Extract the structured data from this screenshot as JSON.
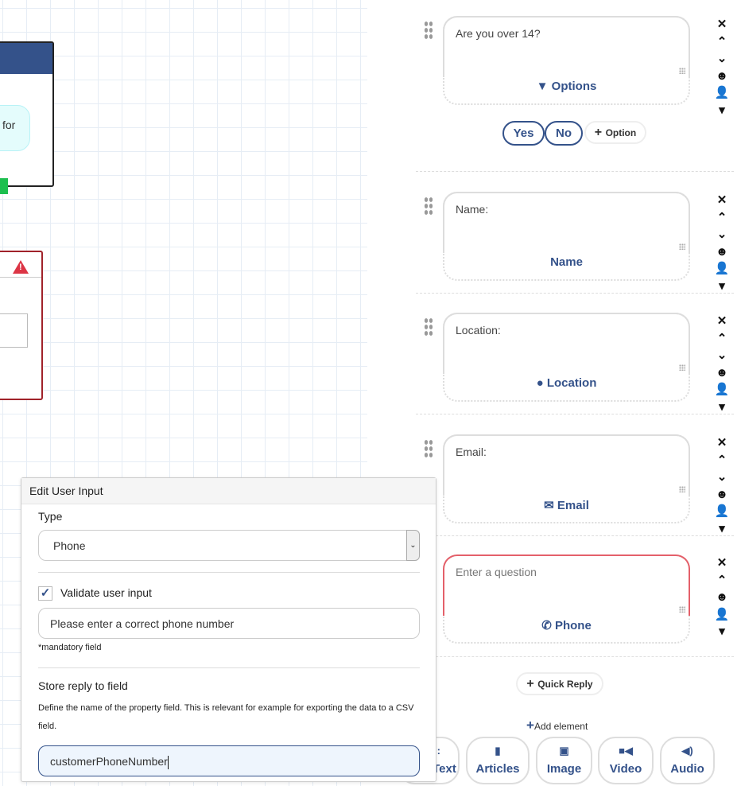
{
  "canvas": {
    "node1_bubble_text": "for",
    "node2_icon": "warning-icon"
  },
  "cards": [
    {
      "question": "Are you over 14?",
      "placeholder": false,
      "footer": "Options",
      "icon": "filter-icon",
      "tools": [
        "close-icon",
        "chevron-up-icon",
        "chevron-down-icon",
        "smiley-icon",
        "user-dropdown-icon"
      ]
    },
    {
      "question": "Name:",
      "placeholder": false,
      "footer": "Name",
      "icon": "",
      "tools": [
        "close-icon",
        "chevron-up-icon",
        "chevron-down-icon",
        "smiley-icon",
        "user-dropdown-icon"
      ]
    },
    {
      "question": "Location:",
      "placeholder": false,
      "footer": "Location",
      "icon": "map-marker-icon",
      "tools": [
        "close-icon",
        "chevron-up-icon",
        "chevron-down-icon",
        "smiley-icon",
        "user-dropdown-icon"
      ]
    },
    {
      "question": "Email:",
      "placeholder": false,
      "footer": "Email",
      "icon": "envelope-icon",
      "tools": [
        "close-icon",
        "chevron-up-icon",
        "chevron-down-icon",
        "smiley-icon",
        "user-dropdown-icon"
      ]
    },
    {
      "question": "Enter a question",
      "placeholder": true,
      "footer": "Phone",
      "icon": "phone-icon",
      "tools": [
        "close-icon",
        "chevron-up-icon",
        "smiley-icon",
        "user-dropdown-icon"
      ]
    }
  ],
  "options": {
    "items": [
      "Yes",
      "No"
    ],
    "add_label": "Option"
  },
  "quick_reply_label": "Quick Reply",
  "add_element_label": "Add element",
  "elements": [
    {
      "label": "Text",
      "icon": "text-icon"
    },
    {
      "label": "Articles",
      "icon": "book-icon"
    },
    {
      "label": "Image",
      "icon": "image-icon"
    },
    {
      "label": "Video",
      "icon": "video-icon"
    },
    {
      "label": "Audio",
      "icon": "audio-icon"
    }
  ],
  "dialog": {
    "title": "Edit User Input",
    "type_label": "Type",
    "type_value": "Phone",
    "validate_label": "Validate user input",
    "validate_checked": true,
    "validate_message": "Please enter a correct phone number",
    "mandatory_note": "*mandatory field",
    "store_label": "Store reply to field",
    "store_help": "Define the name of the property field. This is relevant for example for exporting the data to a CSV field.",
    "store_value": "customerPhoneNumber"
  },
  "colors": {
    "accent": "#34528a",
    "error": "#dc3545",
    "node_header": "#34528a"
  }
}
